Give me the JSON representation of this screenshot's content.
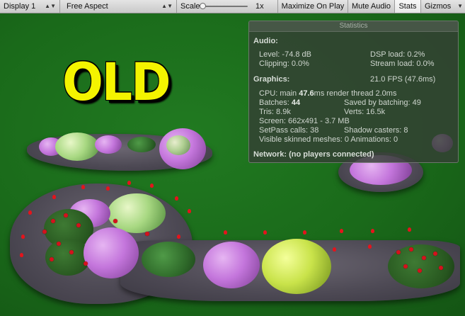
{
  "toolbar": {
    "display": "Display 1",
    "aspect": "Free Aspect",
    "scale_label": "Scale",
    "scale_value": "1x",
    "scale_slider_level": 0,
    "maximize_on_play": "Maximize On Play",
    "mute_audio": "Mute Audio",
    "stats": "Stats",
    "gizmos": "Gizmos"
  },
  "scene": {
    "title_text": "OLD"
  },
  "statistics": {
    "title": "Statistics",
    "audio": {
      "heading": "Audio:",
      "level": "Level: -74.8 dB",
      "clipping": "Clipping: 0.0%",
      "dsp_load": "DSP load: 0.2%",
      "stream_load": "Stream load: 0.0%"
    },
    "graphics": {
      "heading": "Graphics:",
      "fps": "21.0 FPS (47.6ms)",
      "cpu_prefix": "CPU: main ",
      "cpu_main": "47.6",
      "cpu_suffix": "ms  render thread 2.0ms",
      "batches_prefix": "Batches: ",
      "batches": "44",
      "saved_by_batching": "Saved by batching: 49",
      "tris": "Tris: 8.9k",
      "verts": "Verts: 16.5k",
      "screen": "Screen: 662x491 - 3.7 MB",
      "setpass": "SetPass calls: 38",
      "shadow_casters": "Shadow casters: 8",
      "skinned": "Visible skinned meshes: 0  Animations: 0"
    },
    "network": "Network: (no players connected)"
  },
  "colors": {
    "grass": "#1b6b1b",
    "title_yellow": "#f4f400",
    "stats_bg": "#344034"
  }
}
